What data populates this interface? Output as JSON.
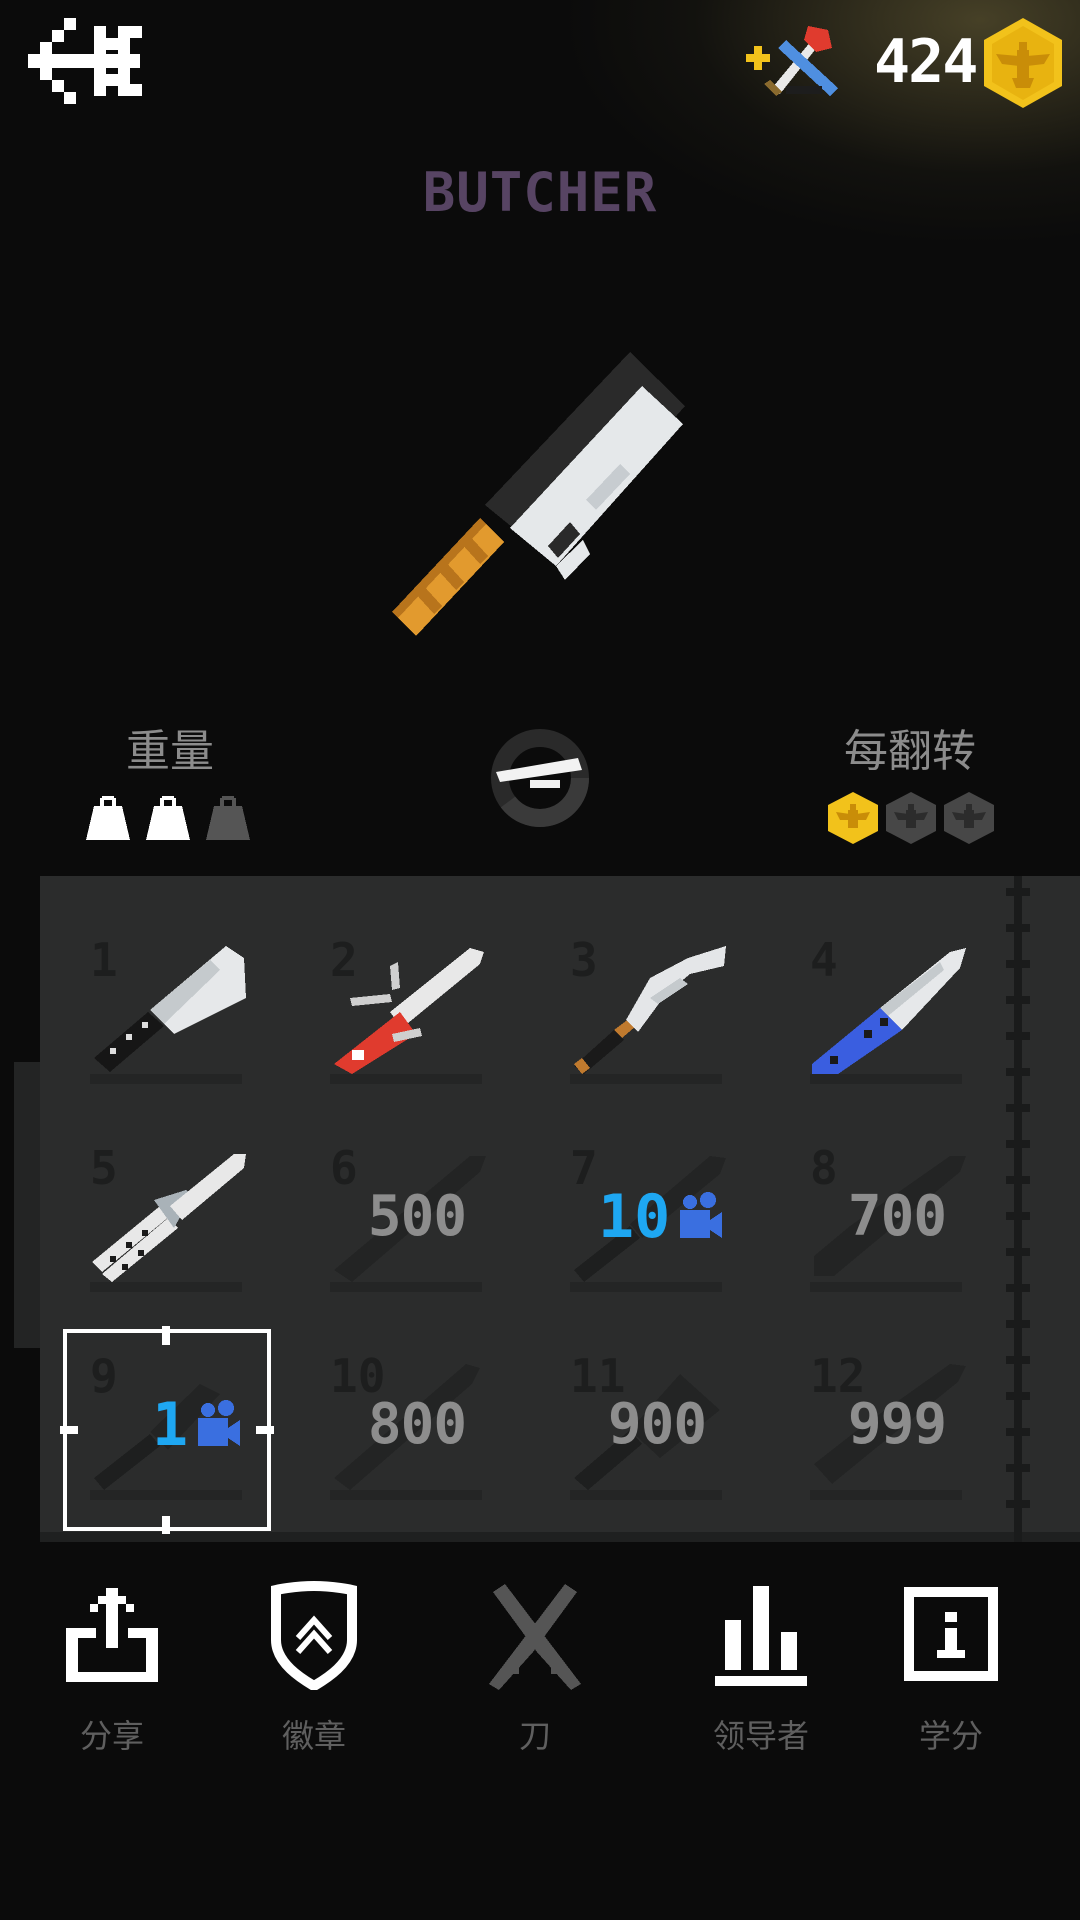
{
  "header": {
    "coins": "424",
    "back_icon": "back-arrow-icon",
    "gift_icon": "add-knife-gift-icon",
    "coin_icon": "eagle-coin-icon"
  },
  "knife": {
    "name": "BUTCHER",
    "name_color": "#574463"
  },
  "stats": {
    "weight_label": "重量",
    "weight_level": 2,
    "weight_max": 3,
    "flip_label": "每翻转",
    "flip_reward": 1,
    "flip_max": 3,
    "rotate_icon": "rotate-icon"
  },
  "grid": {
    "cells": [
      {
        "num": "1",
        "state": "owned"
      },
      {
        "num": "2",
        "state": "owned"
      },
      {
        "num": "3",
        "state": "owned"
      },
      {
        "num": "4",
        "state": "owned"
      },
      {
        "num": "5",
        "state": "owned"
      },
      {
        "num": "6",
        "state": "locked",
        "price": "500"
      },
      {
        "num": "7",
        "state": "video",
        "price": "10"
      },
      {
        "num": "8",
        "state": "locked",
        "price": "700"
      },
      {
        "num": "9",
        "state": "video",
        "price": "1"
      },
      {
        "num": "10",
        "state": "locked",
        "price": "800"
      },
      {
        "num": "11",
        "state": "locked",
        "price": "900"
      },
      {
        "num": "12",
        "state": "locked",
        "price": "999"
      }
    ],
    "selected_index": 9
  },
  "nav": {
    "share": "分享",
    "badges": "徽章",
    "knives": "刀",
    "leaders": "领导者",
    "credits": "学分"
  },
  "colors": {
    "gold": "#f2c21b",
    "video_blue": "#1ea7f2",
    "camera_blue": "#3a6fe0",
    "panel": "#2b2c2c"
  }
}
